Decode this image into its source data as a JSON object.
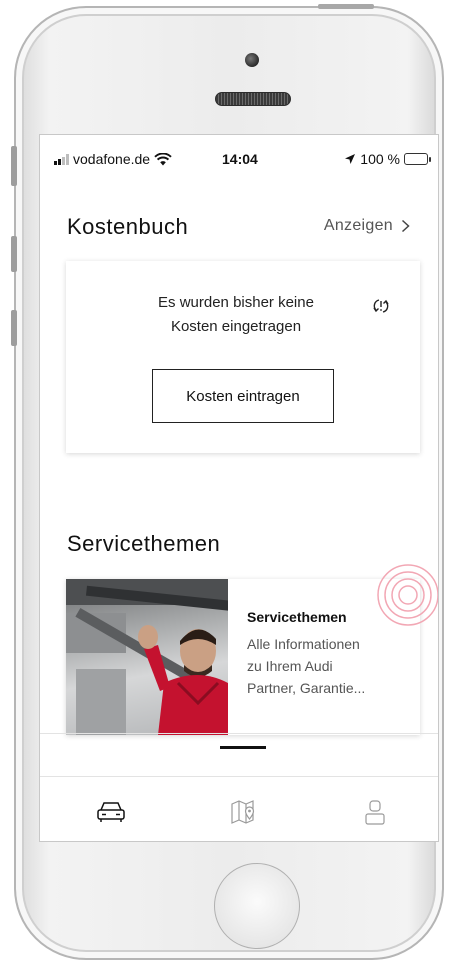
{
  "status_bar": {
    "carrier": "vodafone.de",
    "time": "14:04",
    "battery": "100 %"
  },
  "kostenbuch": {
    "title": "Kostenbuch",
    "link_label": "Anzeigen",
    "empty_line1": "Es wurden bisher keine",
    "empty_line2": "Kosten eingetragen",
    "button_label": "Kosten eintragen"
  },
  "servicethemen": {
    "section_title": "Servicethemen",
    "card_title": "Servicethemen",
    "card_desc_line1": "Alle Informationen",
    "card_desc_line2": "zu Ihrem Audi",
    "card_desc_line3": "Partner, Garantie..."
  },
  "tab_bar": {
    "tabs": [
      {
        "icon": "car-icon",
        "active": true
      },
      {
        "icon": "map-icon",
        "active": false
      },
      {
        "icon": "profile-icon",
        "active": false
      }
    ]
  },
  "colors": {
    "accent_ripple": "#f2a7b4",
    "battery_green": "#4cd964",
    "shirt_red": "#c4122f"
  }
}
